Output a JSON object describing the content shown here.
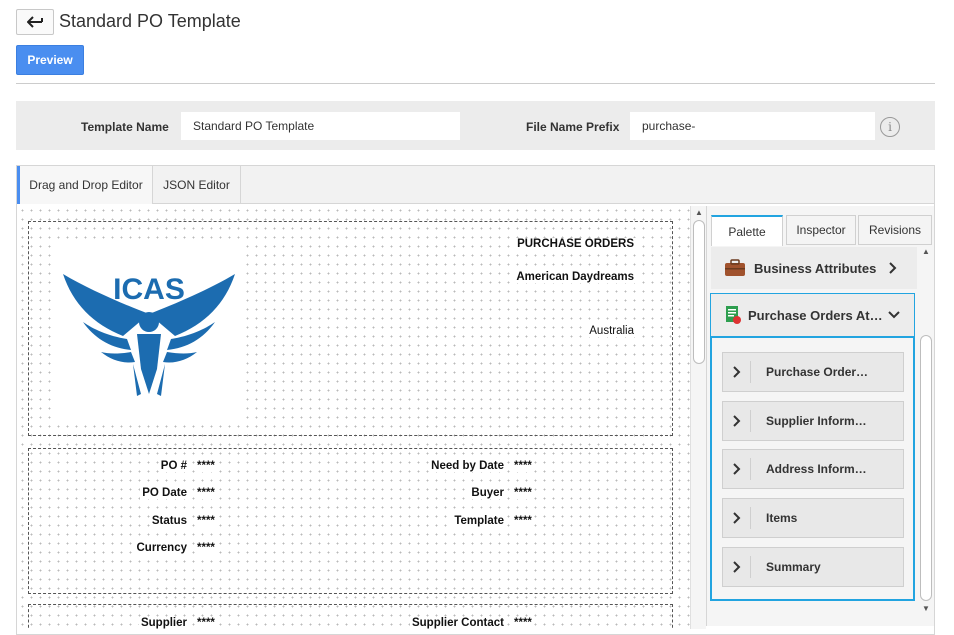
{
  "header": {
    "back_icon": "back-arrow-icon",
    "title": "Standard PO Template",
    "preview_label": "Preview"
  },
  "template_form": {
    "name_label": "Template Name",
    "name_value": "Standard PO Template",
    "prefix_label": "File Name Prefix",
    "prefix_value": "purchase-",
    "info_icon": "info-icon"
  },
  "editor_tabs": [
    {
      "label": "Drag and Drop Editor",
      "active": true
    },
    {
      "label": "JSON Editor",
      "active": false
    }
  ],
  "canvas": {
    "logo_text": "ICAS",
    "doc_title": "PURCHASE ORDERS",
    "company": "American Daydreams",
    "country": "Australia",
    "fields_left": [
      {
        "label": "PO #",
        "value": "****"
      },
      {
        "label": "PO Date",
        "value": "****"
      },
      {
        "label": "Status",
        "value": "****"
      },
      {
        "label": "Currency",
        "value": "****"
      }
    ],
    "fields_right": [
      {
        "label": "Need by Date",
        "value": "****"
      },
      {
        "label": "Buyer",
        "value": "****"
      },
      {
        "label": "Template",
        "value": "****"
      }
    ],
    "supplier_left": {
      "label": "Supplier",
      "value": "****"
    },
    "supplier_right": {
      "label": "Supplier Contact",
      "value": "****"
    }
  },
  "panel": {
    "tabs": [
      "Palette",
      "Inspector",
      "Revisions"
    ],
    "business_attributes": {
      "label": "Business Attributes",
      "icon": "briefcase-icon"
    },
    "po_attributes": {
      "label": "Purchase Orders At…",
      "icon": "document-icon"
    },
    "sub_items": [
      "Purchase Order…",
      "Supplier Inform…",
      "Address Inform…",
      "Items",
      "Summary"
    ]
  },
  "colors": {
    "accent": "#4a8ef0",
    "highlight": "#22a4e0",
    "logo": "#1c6cb0"
  }
}
